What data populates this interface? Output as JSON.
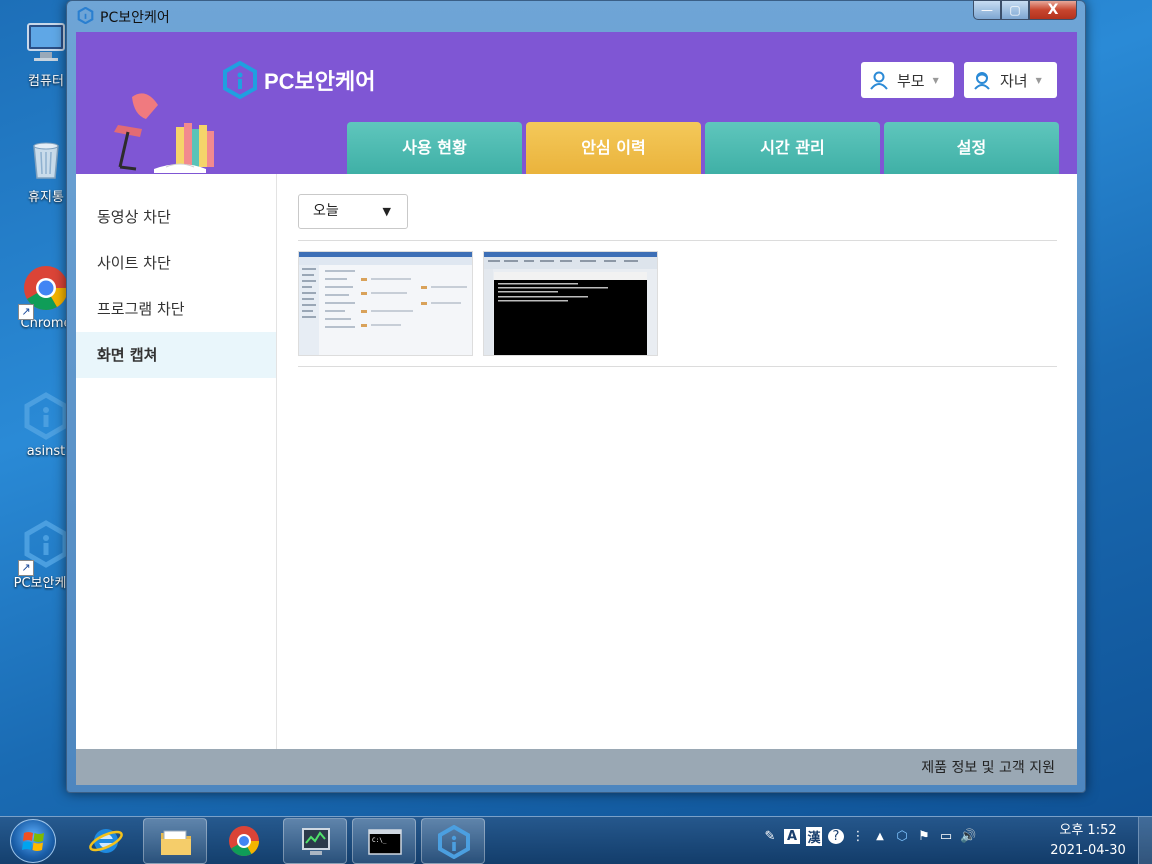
{
  "desktop": {
    "icons": [
      {
        "label": "컴퓨터",
        "icon": "computer-icon"
      },
      {
        "label": "휴지통",
        "icon": "recycle-bin-icon"
      },
      {
        "label": "Chrome",
        "icon": "chrome-icon"
      },
      {
        "label": "asinst",
        "icon": "asinst-icon"
      },
      {
        "label": "PC보안케어",
        "icon": "pc-security-care-icon"
      }
    ]
  },
  "window": {
    "title": "PC보안케어",
    "controls": {
      "minimize": "—",
      "maximize": "▢",
      "close": "X"
    }
  },
  "app": {
    "brand": "PC보안케어",
    "users": [
      {
        "label": "부모",
        "icon": "parent-user-icon"
      },
      {
        "label": "자녀",
        "icon": "child-user-icon"
      }
    ],
    "tabs": [
      {
        "label": "사용 현황",
        "active": false
      },
      {
        "label": "안심 이력",
        "active": true
      },
      {
        "label": "시간 관리",
        "active": false
      },
      {
        "label": "설정",
        "active": false
      }
    ],
    "sidebar": [
      {
        "label": "동영상 차단",
        "active": false
      },
      {
        "label": "사이트 차단",
        "active": false
      },
      {
        "label": "프로그램 차단",
        "active": false
      },
      {
        "label": "화면 캡쳐",
        "active": true
      }
    ],
    "date_filter": {
      "selected": "오늘"
    },
    "captures": [
      {
        "kind": "explorer-screenshot"
      },
      {
        "kind": "console-screenshot"
      }
    ],
    "footer": {
      "support_link": "제품 정보 및 고객 지원"
    },
    "colors": {
      "header": "#7f56d4",
      "tab": "#4bb8ae",
      "tab_active": "#efbe4a"
    }
  },
  "taskbar": {
    "pinned": [
      "start-orb",
      "internet-explorer-icon",
      "file-explorer-icon",
      "chrome-icon",
      "task-manager-icon",
      "command-prompt-icon",
      "pc-security-care-icon"
    ],
    "tray_icons": [
      "✎",
      "A",
      "漢",
      "?",
      "⋮",
      "▲",
      "⬡",
      "⚑",
      "▭",
      "🔊"
    ],
    "clock": {
      "period_time": "오후 1:52",
      "date": "2021-04-30"
    }
  }
}
